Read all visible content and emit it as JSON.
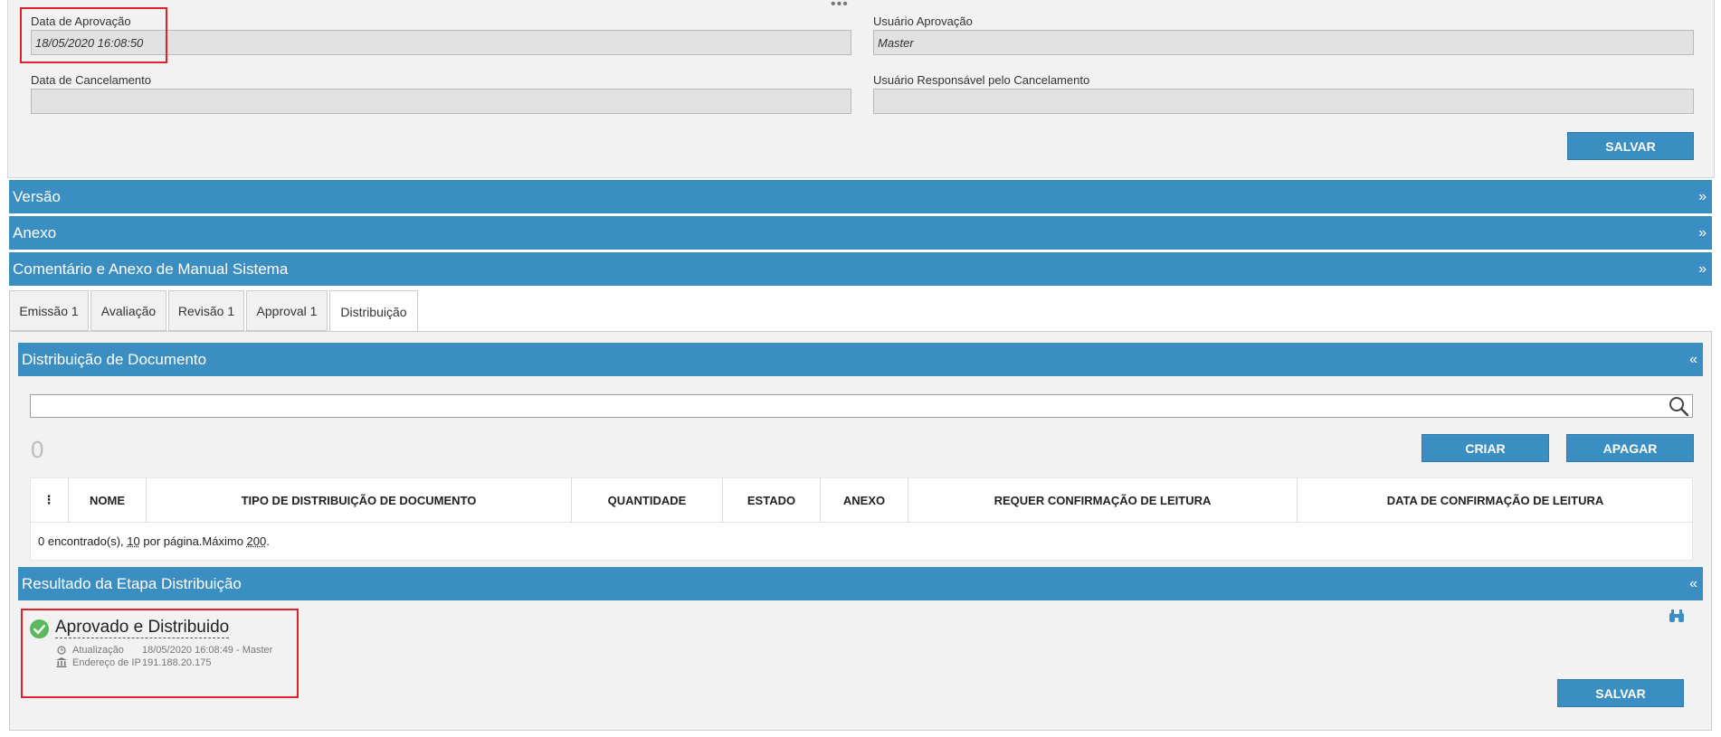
{
  "top_form": {
    "approval_date_label": "Data de Aprovação",
    "approval_date_value": "18/05/2020 16:08:50",
    "approval_user_label": "Usuário Aprovação",
    "approval_user_value": "Master",
    "cancel_date_label": "Data de Cancelamento",
    "cancel_date_value": "",
    "cancel_user_label": "Usuário Responsável pelo Cancelamento",
    "cancel_user_value": "",
    "save_label": "SALVAR"
  },
  "sections": {
    "versao": "Versão",
    "anexo": "Anexo",
    "comentario": "Comentário e Anexo de Manual Sistema",
    "expand_chevron": "»",
    "collapse_chevron": "«"
  },
  "tabs": [
    {
      "label": "Emissão 1"
    },
    {
      "label": "Avaliação"
    },
    {
      "label": "Revisão 1"
    },
    {
      "label": "Approval 1"
    },
    {
      "label": "Distribuição"
    }
  ],
  "distribution": {
    "title": "Distribuição de Documento",
    "search_placeholder": "",
    "count": "0",
    "create_label": "CRIAR",
    "delete_label": "APAGAR",
    "columns": [
      "⋮",
      "NOME",
      "TIPO DE DISTRIBUIÇÃO DE DOCUMENTO",
      "QUANTIDADE",
      "ESTADO",
      "ANEXO",
      "REQUER CONFIRMAÇÃO DE LEITURA",
      "DATA DE CONFIRMAÇÃO DE LEITURA"
    ],
    "footer_found": "0 encontrado(s), ",
    "footer_per_page_num": "10",
    "footer_per_page": " por página.Máximo ",
    "footer_max_num": "200",
    "footer_end": "."
  },
  "result": {
    "title": "Resultado da Etapa Distribuição",
    "status": "Aprovado e Distribuido",
    "updated_label": "Atualização",
    "updated_value": "18/05/2020 16:08:49 - Master",
    "ip_label": "Endereço de IP",
    "ip_value": "191.188.20.175",
    "save_label": "SALVAR"
  },
  "colors": {
    "accent": "#3a8ec1",
    "highlight": "#e0212b",
    "success": "#5cb85c"
  }
}
